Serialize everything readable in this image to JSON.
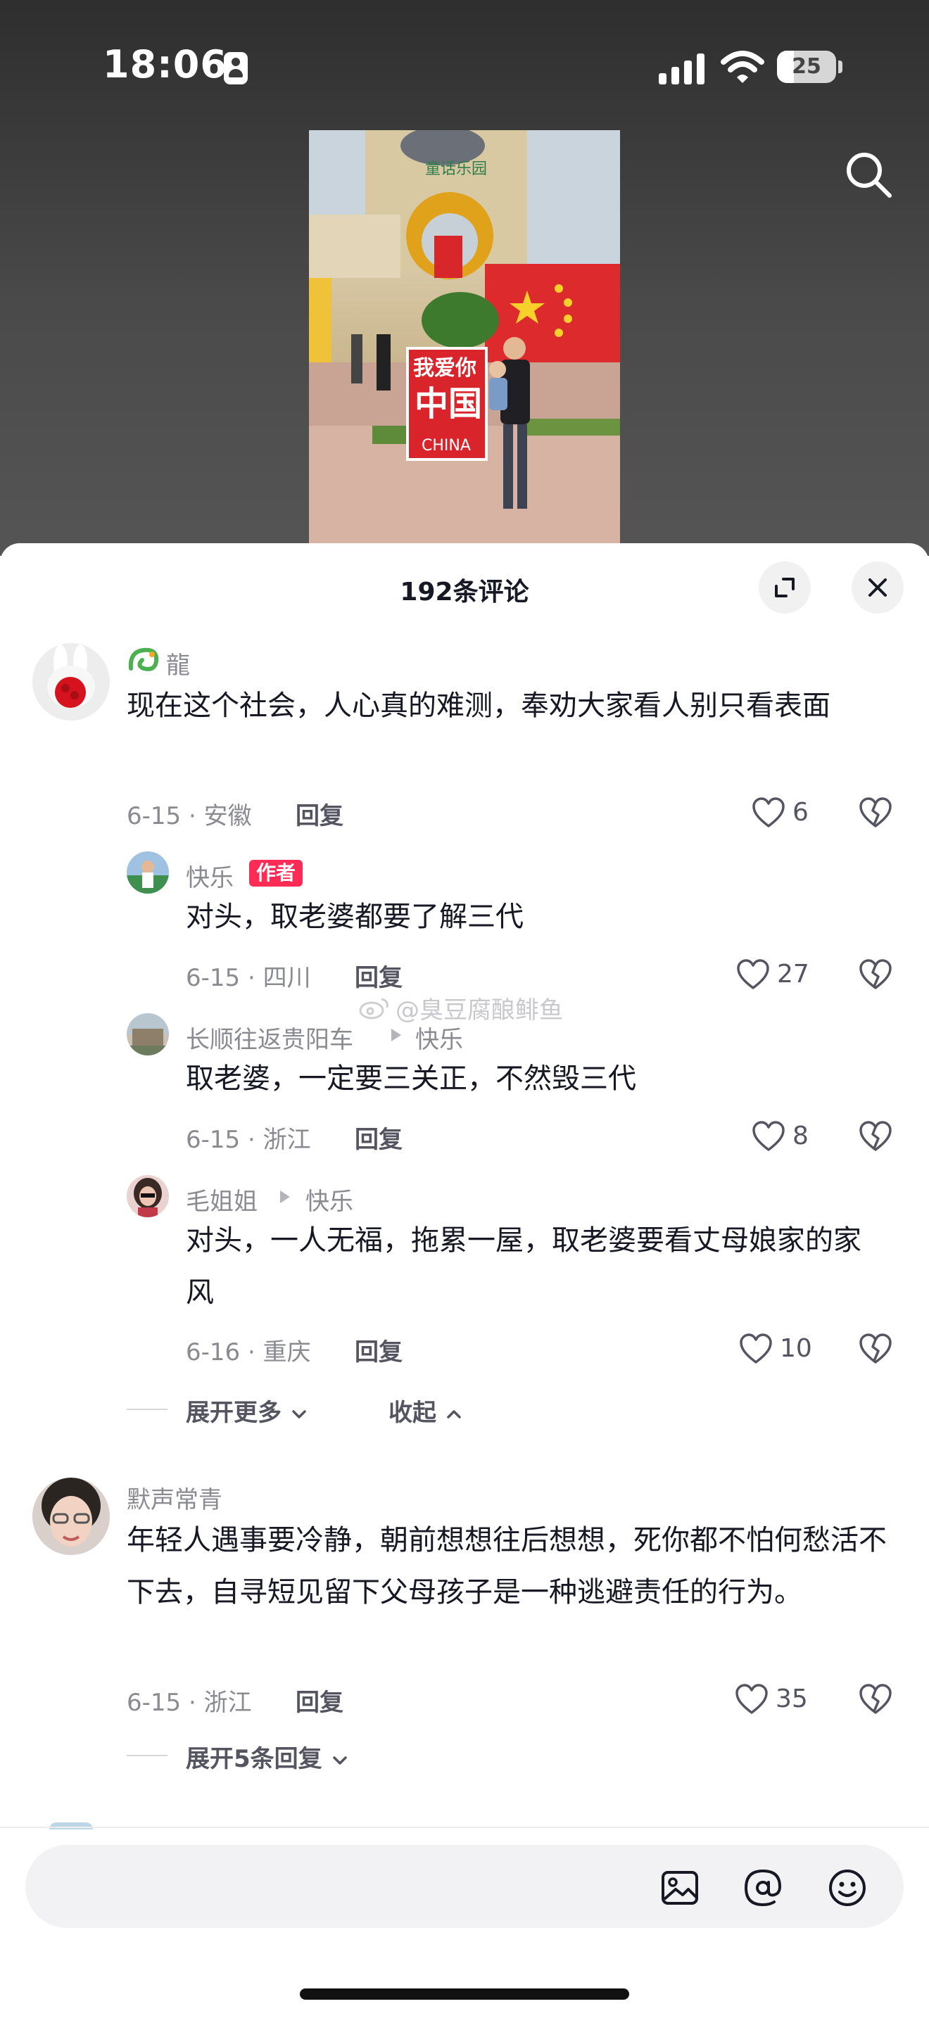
{
  "status_bar": {
    "time": "18:06",
    "battery": "25"
  },
  "panel": {
    "title": "192条评论"
  },
  "comments": [
    {
      "user": "龍",
      "text": "现在这个社会，人心真的难测，奉劝大家看人别只看表面",
      "date_location": "6-15 · 安徽",
      "reply_label": "回复",
      "likes": "6"
    },
    {
      "user": "默声常青",
      "text": "年轻人遇事要冷静，朝前想想往后想想，死你都不怕何愁活不下去，自寻短见留下父母孩子是一种逃避责任的行为。",
      "date_location": "6-15 · 浙江",
      "reply_label": "回复",
      "likes": "35",
      "expand_label": "展开5条回复"
    }
  ],
  "replies": [
    {
      "user": "快乐",
      "badge": "作者",
      "text": "对头，取老婆都要了解三代",
      "date_location": "6-15 · 四川",
      "reply_label": "回复",
      "likes": "27"
    },
    {
      "user": "长顺往返贵阳车",
      "reply_to": "快乐",
      "text": "取老婆，一定要三关正，不然毁三代",
      "date_location": "6-15 · 浙江",
      "reply_label": "回复",
      "likes": "8"
    },
    {
      "user": "毛姐姐",
      "reply_to": "快乐",
      "text": "对头，一人无福，拖累一屋，取老婆要看丈母娘家的家风",
      "date_location": "6-16 · 重庆",
      "reply_label": "回复",
      "likes": "10"
    }
  ],
  "thread_controls": {
    "expand_more": "展开更多",
    "collapse": "收起"
  },
  "watermark": "@臭豆腐酿鲱鱼",
  "video": {
    "banner_line1": "我爱你",
    "banner_line2": "中国",
    "banner_line3": "CHINA"
  },
  "input": {
    "value": ""
  },
  "colors": {
    "accent": "#fe2c55",
    "text_primary": "#161823",
    "text_secondary": "#8a8b91"
  },
  "icons": [
    "search-icon",
    "expand-icon",
    "close-icon",
    "heart-icon",
    "dislike-icon",
    "image-icon",
    "at-icon",
    "emoji-icon"
  ]
}
